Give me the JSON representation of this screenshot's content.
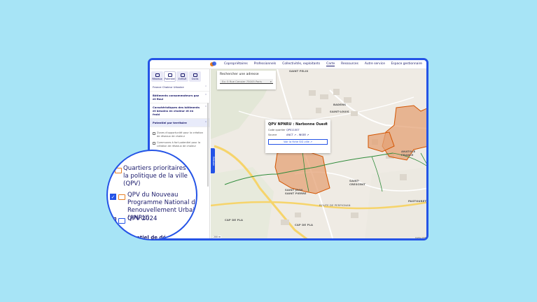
{
  "nav": {
    "items": [
      "Copropriétaires",
      "Professionnels",
      "Collectivités, exploitants",
      "Carte",
      "Ressources",
      "Autre service"
    ],
    "active": "Carte",
    "espace": "Espace gestionnaire"
  },
  "sidebar": {
    "tabs": [
      "Réseaux",
      "Potentiel",
      "EnR&R",
      "Outils"
    ],
    "rows": [
      {
        "label": "France Chaleur Urbaine",
        "bold": false
      },
      {
        "label": "Bâtiments consommateurs gaz et fioul",
        "bold": true
      },
      {
        "label": "Caractéristiques des bâtiments et besoins en chaleur et en froid",
        "bold": true
      },
      {
        "label": "Potentiel par territoire",
        "bold": true,
        "highlight": true
      }
    ],
    "checks": [
      "Zones d'opportunité pour la création de réseaux de chaleur",
      "Communes à fort potentiel pour la création de réseaux de chaleur"
    ],
    "collapse_label": "Réduire"
  },
  "search": {
    "title": "Rechercher une adresse",
    "placeholder": "Ex: 5 Rue Censier 75005 Paris"
  },
  "popup": {
    "title": "QPV NPNRU : Narbonne Ouest",
    "close": "×",
    "rows": [
      {
        "key": "Code quartier",
        "value": "QP011007"
      },
      {
        "key": "Source",
        "value": "ANCT ↗ - INSEE ↗"
      }
    ],
    "button": "Voir la fiche SIG ville ↗"
  },
  "map_labels": [
    "SAINT FELIX",
    "BADENS",
    "SAINT-LOUIS",
    "ANATOLE FRANCE",
    "SAINT JEAN SAINT PIERRE",
    "SAINT-CRESCENT",
    "PASTOURET",
    "CAP DE PLA",
    "CAP DE PLA",
    "ROUTE DE PERPIGNAN"
  ],
  "zoom": {
    "group_label": "Quartiers prioritaires de la politique de la ville (QPV)",
    "item1": "QPV du Nouveau Programme National de Renouvellement Urbain (ANRU)",
    "item1_checked": "✓",
    "item2": "QPV 2024",
    "footer": "otentiel de dé"
  },
  "scale": "200 m",
  "attribution": "Carte OSM"
}
